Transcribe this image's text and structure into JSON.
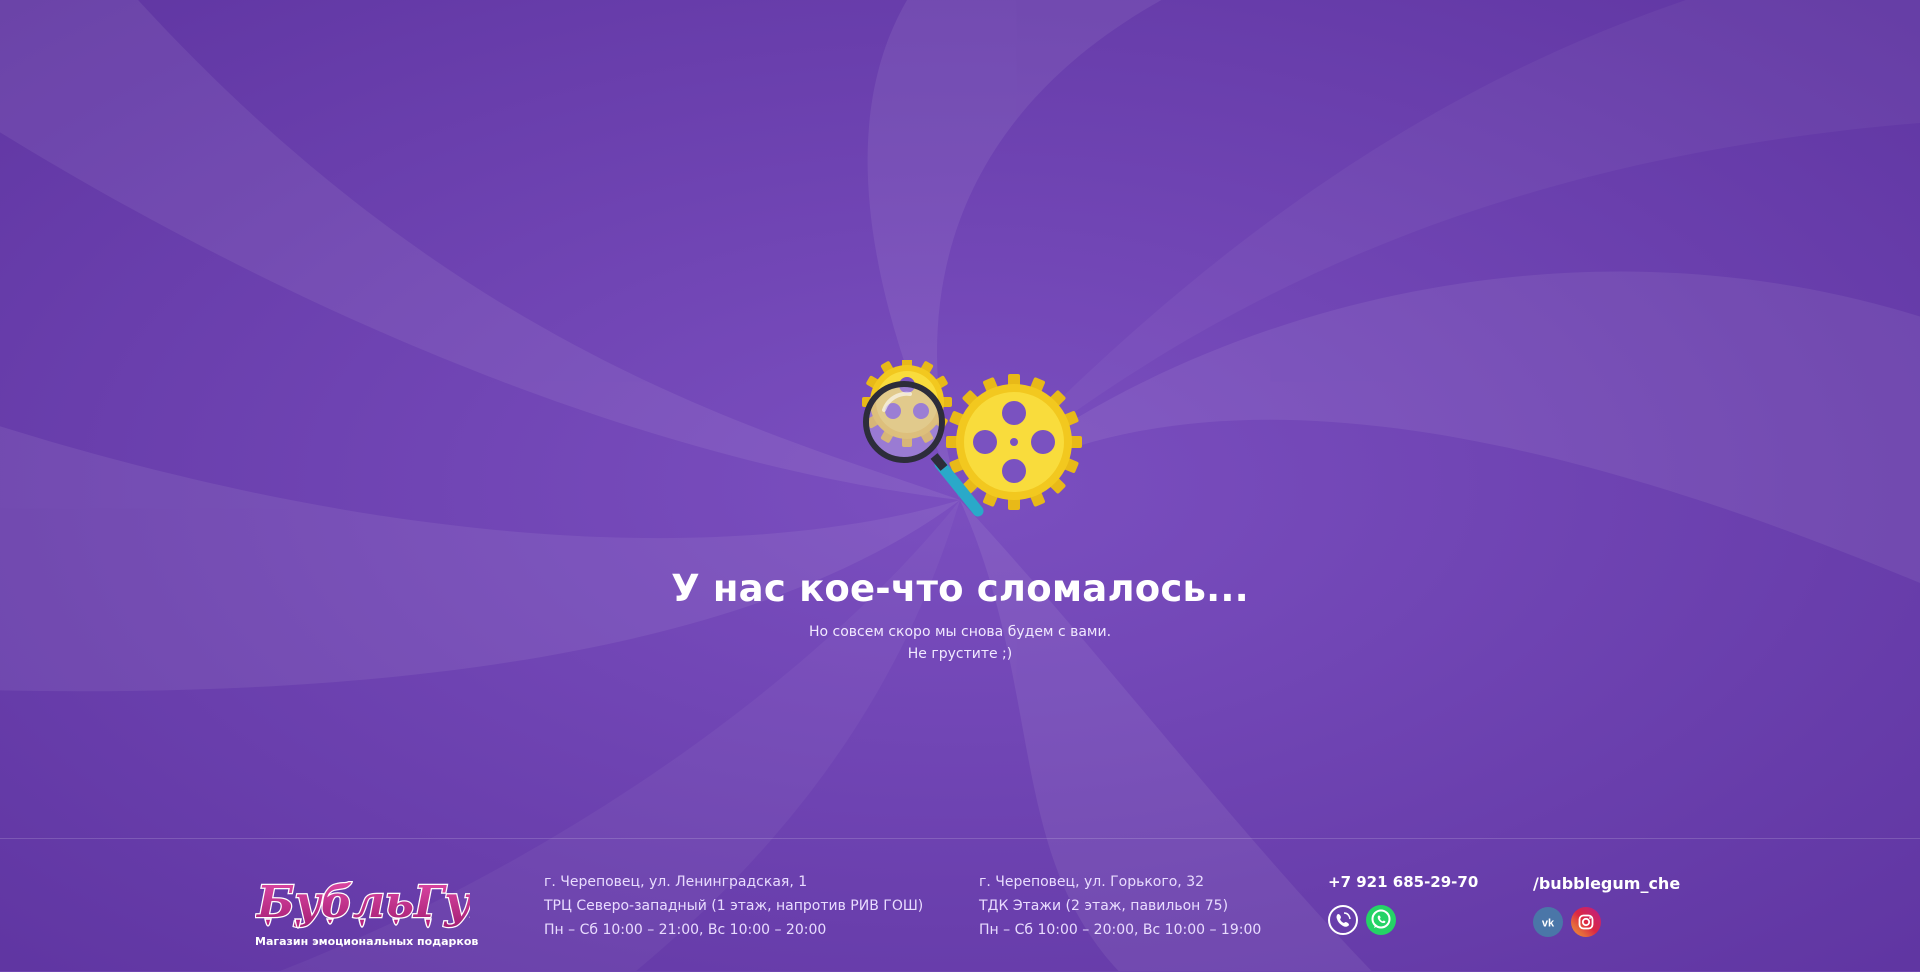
{
  "hero": {
    "title": "У нас кое-что сломалось...",
    "subtitle_line1": "Но совсем скоро мы снова будем с вами.",
    "subtitle_line2": "Не грустите ;)"
  },
  "brand": {
    "name": "БубльГум",
    "tagline": "Магазин эмоциональных подарков"
  },
  "stores": [
    {
      "address": "г. Череповец, ул. Ленинградская, 1",
      "place": "ТРЦ Северо-западный (1 этаж, напротив РИВ ГОШ)",
      "hours": "Пн – Сб  10:00 – 21:00, Вс 10:00 – 20:00"
    },
    {
      "address": "г. Череповец, ул. Горького, 32",
      "place": "ТДК Этажи (2 этаж, павильон 75)",
      "hours": "Пн – Сб  10:00 – 20:00, Вс 10:00 – 19:00"
    }
  ],
  "contacts": {
    "phone": "+7 921 685-29-70",
    "messengers": [
      {
        "icon": "viber-icon"
      },
      {
        "icon": "whatsapp-icon"
      }
    ]
  },
  "social": {
    "handle": "/bubblegum_che",
    "networks": [
      {
        "icon": "vk-icon",
        "color": "#4a76a8"
      },
      {
        "icon": "instagram-icon",
        "color": "#d6249f"
      }
    ]
  },
  "colors": {
    "background": "#7045b2",
    "gear": "#f7d42e",
    "logo": "#c2278a"
  }
}
